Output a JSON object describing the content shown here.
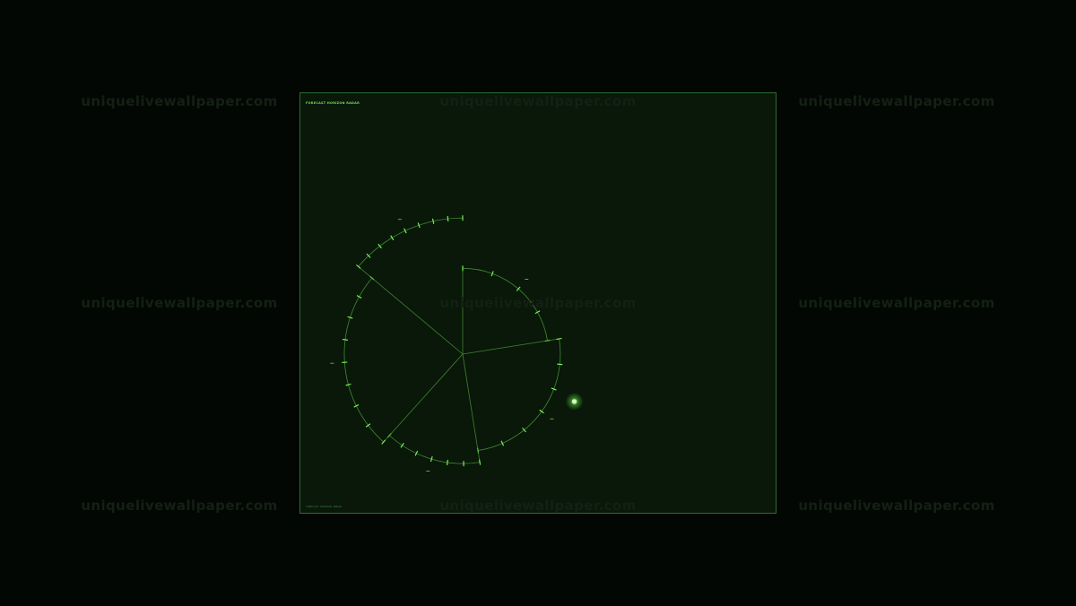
{
  "watermark": {
    "text": "uniquelivewallpaper.com"
  },
  "panel": {
    "title": "FORECAST HORIZON RADAR",
    "footer": "FORECAST HORIZON RADAR"
  },
  "radar": {
    "type": "radial-sectors",
    "sectors": [
      {
        "start_deg": 0,
        "end_deg": 81,
        "radius": 0.58,
        "ticks": 4
      },
      {
        "start_deg": 81,
        "end_deg": 171,
        "radius": 0.66,
        "ticks": 6
      },
      {
        "start_deg": 171,
        "end_deg": 222,
        "radius": 0.74,
        "ticks": 6
      },
      {
        "start_deg": 222,
        "end_deg": 310,
        "radius": 0.8,
        "ticks": 8
      },
      {
        "start_deg": 310,
        "end_deg": 360,
        "radius": 0.92,
        "ticks": 8
      }
    ],
    "max_radius": 1.0,
    "blip": {
      "angle_deg": 113,
      "distance": 0.82
    },
    "colors": {
      "stroke": "#4f9a3c",
      "tick": "#7dff5c",
      "blip": "#d8ffc0",
      "glow": "#6cff4a"
    }
  }
}
